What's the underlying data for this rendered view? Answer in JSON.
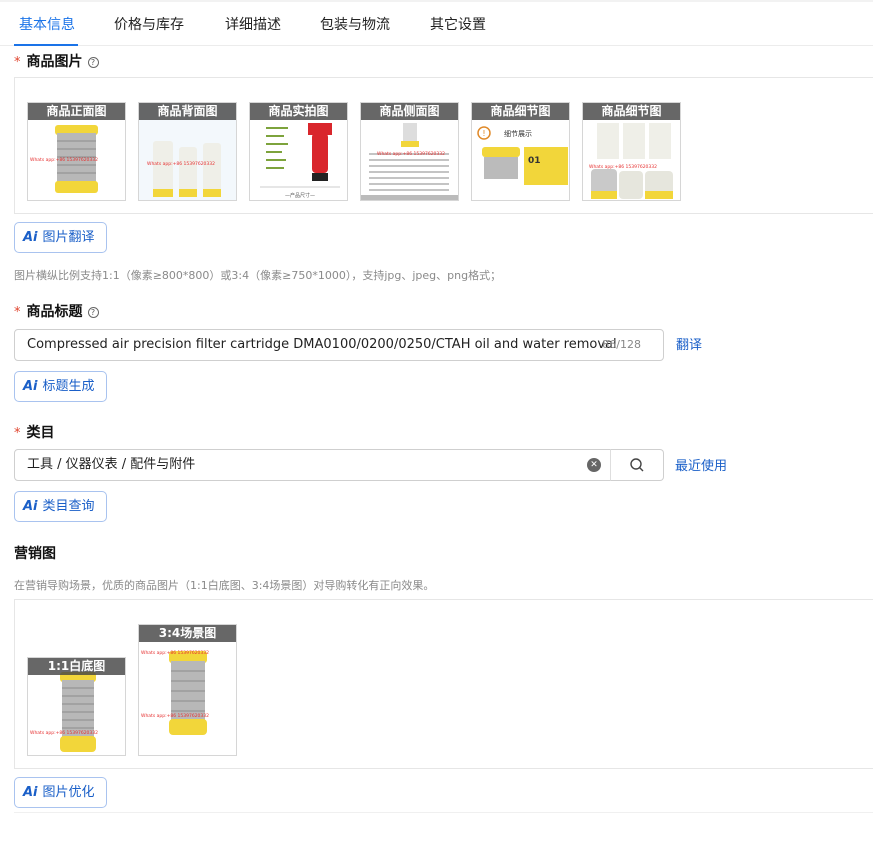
{
  "tabs": [
    {
      "label": "基本信息"
    },
    {
      "label": "价格与库存"
    },
    {
      "label": "详细描述"
    },
    {
      "label": "包装与物流"
    },
    {
      "label": "其它设置"
    }
  ],
  "product_images": {
    "required_mark": "*",
    "label": "商品图片",
    "items": [
      {
        "caption": "商品正面图"
      },
      {
        "caption": "商品背面图"
      },
      {
        "caption": "商品实拍图"
      },
      {
        "caption": "商品侧面图"
      },
      {
        "caption": "商品细节图"
      },
      {
        "caption": "商品细节图"
      }
    ],
    "thumb_text": {
      "detail_title": "细节展示",
      "detail_number": "01",
      "size_label": "—产品尺寸—"
    },
    "translate_button": "图片翻译",
    "hint": "图片横纵比例支持1:1（像素≥800*800）或3:4（像素≥750*1000），支持jpg、jpeg、png格式；"
  },
  "product_title": {
    "required_mark": "*",
    "label": "商品标题",
    "value": "Compressed air precision filter cartridge DMA0100/0200/0250/CTAH oil and water removal",
    "counter": "86/128",
    "translate_link": "翻译",
    "generate_button": "标题生成"
  },
  "category": {
    "required_mark": "*",
    "label": "类目",
    "value": "工具 / 仪器仪表 / 配件与附件",
    "recent_link": "最近使用",
    "query_button": "类目查询"
  },
  "marketing": {
    "label": "营销图",
    "hint": "在营销导购场景，优质的商品图片（1:1白底图、3:4场景图）对导购转化有正向效果。",
    "items": [
      {
        "caption": "1:1白底图"
      },
      {
        "caption": "3:4场景图"
      }
    ],
    "optimize_button": "图片优化"
  },
  "ai_glyph": "Ai",
  "watermark": "Whats app:+86 15397620332",
  "colors": {
    "accent": "#1a73e8",
    "ai_blue": "#1a5fc8",
    "required": "#e0442e",
    "product_yellow": "#f2d63a",
    "filter_red": "#d9262c"
  }
}
